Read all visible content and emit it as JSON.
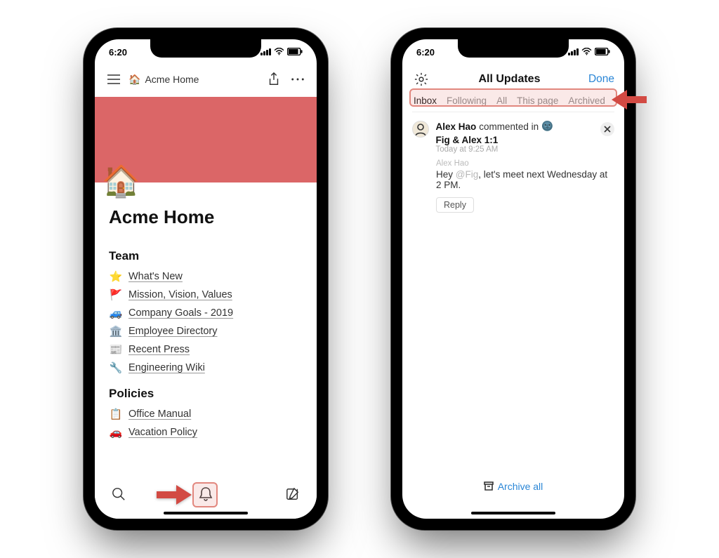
{
  "status": {
    "time": "6:20"
  },
  "phone1": {
    "breadcrumb_icon": "🏠",
    "breadcrumb_title": "Acme Home",
    "banner_emoji": "🏠",
    "page_title": "Acme Home",
    "sections": [
      {
        "heading": "Team",
        "links": [
          {
            "emoji": "⭐",
            "label": "What's New"
          },
          {
            "emoji": "🚩",
            "label": "Mission, Vision, Values"
          },
          {
            "emoji": "🚙",
            "label": "Company Goals - 2019"
          },
          {
            "emoji": "🏛️",
            "label": "Employee Directory"
          },
          {
            "emoji": "📰",
            "label": "Recent Press"
          },
          {
            "emoji": "🔧",
            "label": "Engineering Wiki"
          }
        ]
      },
      {
        "heading": "Policies",
        "links": [
          {
            "emoji": "📋",
            "label": "Office Manual"
          },
          {
            "emoji": "🚗",
            "label": "Vacation Policy"
          }
        ]
      }
    ]
  },
  "phone2": {
    "header_title": "All Updates",
    "done_label": "Done",
    "tabs": [
      "Inbox",
      "Following",
      "All",
      "This page",
      "Archived"
    ],
    "active_tab": "Inbox",
    "update": {
      "actor": "Alex Hao",
      "action": "commented in",
      "page_emoji": "🌚",
      "page_name": "Fig & Alex 1:1",
      "time": "Today at 9:25 AM",
      "comment_author": "Alex Hao",
      "comment_prefix": "Hey ",
      "comment_mention": "@Fig",
      "comment_rest": ", let's meet next Wednesday at 2 PM.",
      "reply_label": "Reply"
    },
    "archive_all_label": "Archive all"
  }
}
